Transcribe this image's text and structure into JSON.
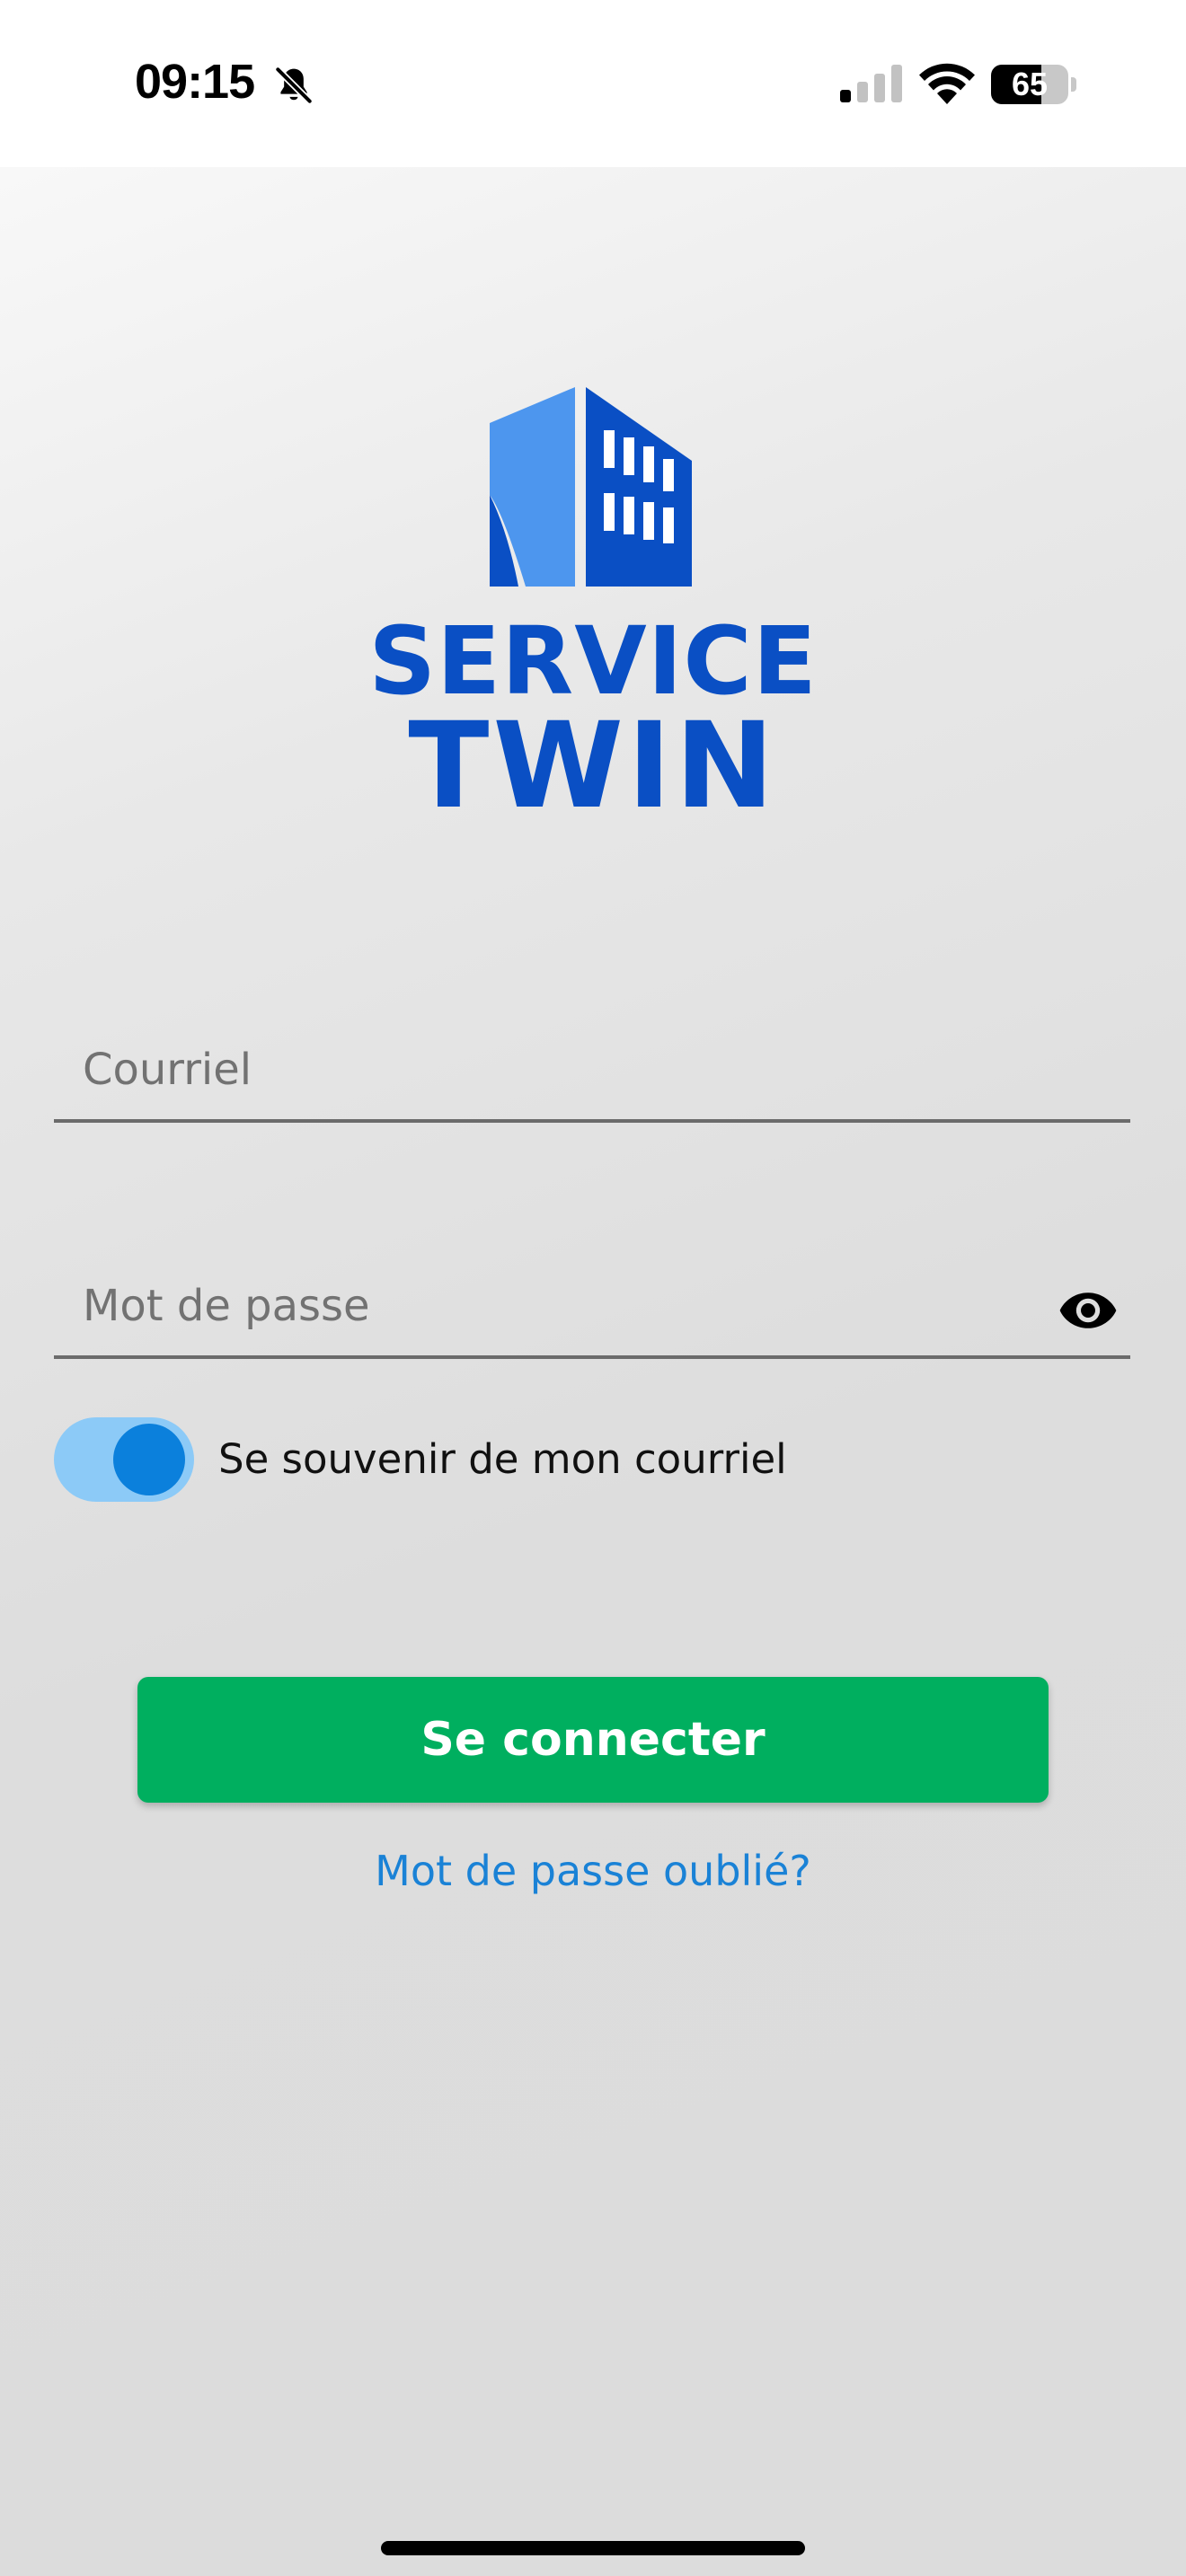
{
  "status_bar": {
    "time": "09:15",
    "battery_level": "65",
    "battery_fraction": 0.65,
    "icons": [
      "bell-slash-icon",
      "cellular-signal-icon",
      "wifi-icon",
      "battery-icon"
    ]
  },
  "logo": {
    "line1": "SERVICE",
    "line2": "TWIN",
    "color": "#0a4fc4",
    "accent_color": "#4d96ee"
  },
  "form": {
    "email_placeholder": "Courriel",
    "email_value": "",
    "password_placeholder": "Mot de passe",
    "password_value": "",
    "password_toggle_icon": "eye-icon",
    "remember_label": "Se souvenir de mon courriel",
    "remember_checked": true,
    "login_label": "Se connecter",
    "forgot_label": "Mot de passe oublié?"
  },
  "colors": {
    "login_button": "#00af5f",
    "link": "#1a82d6",
    "toggle_track": "#8ccaf7",
    "toggle_thumb": "#0b80dc"
  }
}
